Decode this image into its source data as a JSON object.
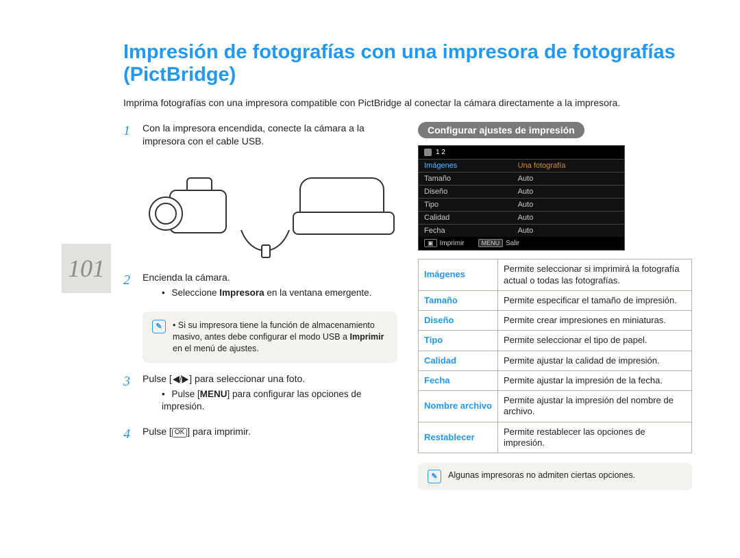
{
  "page_number": "101",
  "title": "Impresión de fotografías con una impresora de fotografías (PictBridge)",
  "intro": "Imprima fotografías con una impresora compatible con PictBridge al conectar la cámara directamente a la impresora.",
  "steps": {
    "s1": {
      "num": "1",
      "text": "Con la impresora encendida, conecte la cámara a la impresora con el cable USB."
    },
    "s2": {
      "num": "2",
      "text": "Encienda la cámara.",
      "bullet": "Seleccione ",
      "bold": "Impresora",
      "bullet_tail": " en la ventana emergente."
    },
    "s3": {
      "num": "3",
      "head": "Pulse [",
      "glyph": "◀/▶",
      "tail": "] para seleccionar una foto.",
      "bullet_head": "Pulse [",
      "bullet_bold": "MENU",
      "bullet_tail": "] para configurar las opciones de impresión."
    },
    "s4": {
      "num": "4",
      "head": "Pulse [",
      "icon": "OK",
      "tail": "] para imprimir."
    }
  },
  "note1": {
    "line1": "Si su impresora tiene la función de almacenamiento masivo, antes debe configurar el modo USB a ",
    "bold": "Imprimir",
    "line2": " en el menú de ajustes."
  },
  "right": {
    "section_title": "Configurar ajustes de impresión",
    "lcd": {
      "tab_group": "1  2",
      "rows": [
        {
          "k": "Imágenes",
          "v": "Una fotografía",
          "hl": true
        },
        {
          "k": "Tamaño",
          "v": "Auto"
        },
        {
          "k": "Diseño",
          "v": "Auto"
        },
        {
          "k": "Tipo",
          "v": "Auto"
        },
        {
          "k": "Calidad",
          "v": "Auto"
        },
        {
          "k": "Fecha",
          "v": "Auto"
        }
      ],
      "foot_print_btn": "▣",
      "foot_print": "Imprimir",
      "foot_exit_btn": "MENU",
      "foot_exit": "Salir"
    },
    "table": [
      {
        "k": "Imágenes",
        "v": "Permite seleccionar si imprimirá la fotografía actual o todas las fotografías."
      },
      {
        "k": "Tamaño",
        "v": "Permite especificar el tamaño de impresión."
      },
      {
        "k": "Diseño",
        "v": "Permite crear impresiones en miniaturas."
      },
      {
        "k": "Tipo",
        "v": "Permite seleccionar el tipo de papel."
      },
      {
        "k": "Calidad",
        "v": "Permite ajustar la calidad de impresión."
      },
      {
        "k": "Fecha",
        "v": "Permite ajustar la impresión de la fecha."
      },
      {
        "k": "Nombre archivo",
        "v": "Permite ajustar la impresión del nombre de archivo."
      },
      {
        "k": "Restablecer",
        "v": "Permite restablecer las opciones de impresión."
      }
    ],
    "note2": "Algunas impresoras no admiten ciertas opciones."
  }
}
